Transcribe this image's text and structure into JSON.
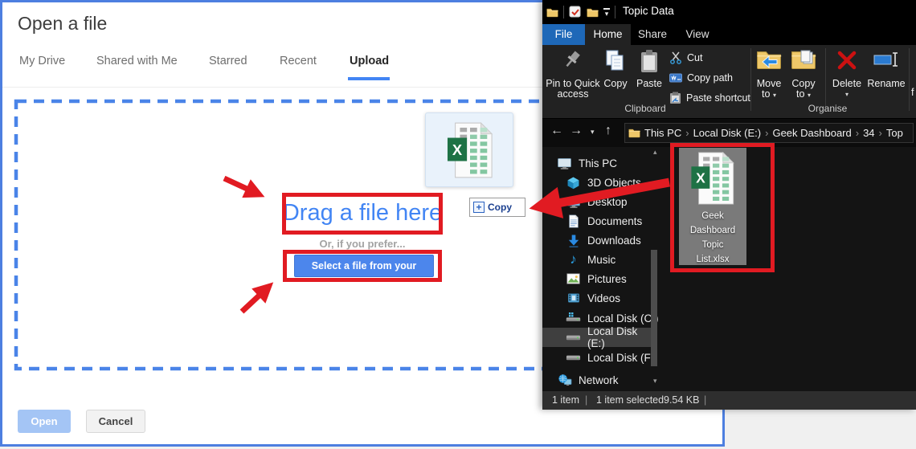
{
  "icons": {
    "caret": "▾",
    "back_arrow": "←",
    "forward_arrow": "→",
    "up_arrow": "↑",
    "breadcrumb_separator": "›",
    "music_note": "♪",
    "scroll_up": "▴",
    "scroll_down": "▾",
    "plus": "+",
    "excel_x": "X",
    "divider": "|"
  },
  "colors": {
    "accent_blue": "#4285f4",
    "annotation_red": "#e11b22",
    "dialog_border": "#4d7fe0",
    "excel_green": "#1e7245",
    "file_tab_blue": "#1e68b8"
  },
  "dialog": {
    "title": "Open a file",
    "tabs": [
      "My Drive",
      "Shared with Me",
      "Starred",
      "Recent",
      "Upload"
    ],
    "active_tab": "Upload",
    "dropzone": {
      "drag_text": "Drag a file here",
      "or_text": "Or, if you prefer...",
      "select_button": "Select a file from your device"
    },
    "open_button": "Open",
    "cancel_button": "Cancel"
  },
  "drag_ghost": {
    "tooltip": "Copy"
  },
  "explorer": {
    "window_title": "Topic Data",
    "menu_tabs": [
      "File",
      "Home",
      "Share",
      "View"
    ],
    "ribbon": {
      "groups": [
        {
          "label": "Clipboard",
          "big": [
            {
              "label": "Pin to Quick access"
            },
            {
              "label": "Copy"
            },
            {
              "label": "Paste"
            }
          ],
          "small": [
            {
              "label": "Cut"
            },
            {
              "label": "Copy path"
            },
            {
              "label": "Paste shortcut"
            }
          ]
        },
        {
          "label": "Organise",
          "big": [
            {
              "label": "Move to"
            },
            {
              "label": "Copy to"
            },
            {
              "label": "Delete"
            },
            {
              "label": "Rename"
            }
          ]
        }
      ],
      "overflow_hint": "f"
    },
    "breadcrumb": [
      "This PC",
      "Local Disk (E:)",
      "Geek Dashboard",
      "34",
      "Top"
    ],
    "sidebar": [
      {
        "label": "This PC"
      },
      {
        "label": "3D Objects"
      },
      {
        "label": "Desktop"
      },
      {
        "label": "Documents"
      },
      {
        "label": "Downloads"
      },
      {
        "label": "Music"
      },
      {
        "label": "Pictures"
      },
      {
        "label": "Videos"
      },
      {
        "label": "Local Disk (C:)"
      },
      {
        "label": "Local Disk (E:)",
        "selected": true
      },
      {
        "label": "Local Disk (F:)"
      },
      {
        "label": "Network"
      }
    ],
    "file": {
      "full_name": "Geek Dashboard Topic List.xlsx",
      "name_lines": [
        "Geek",
        "Dashboard",
        "Topic",
        "List.xlsx"
      ]
    },
    "status_bar": {
      "count": "1 item",
      "selection": "1 item selected",
      "size": "9.54 KB"
    }
  }
}
